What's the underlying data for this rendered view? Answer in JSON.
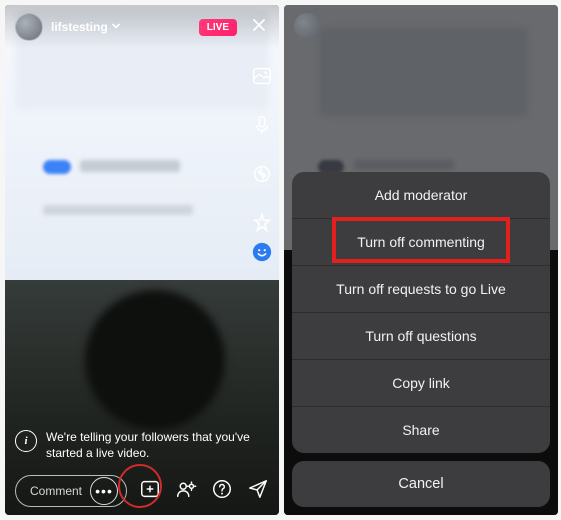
{
  "left": {
    "username": "lifstesting",
    "live_badge": "LIVE",
    "side_icons": [
      "image-icon",
      "mic-icon",
      "camera-flip-icon",
      "filter-icon",
      "blue-face-icon"
    ],
    "notice": "We're telling your followers that you've started a live video.",
    "comment_placeholder": "Comment",
    "bottom_icons": [
      "add-media-icon",
      "add-guest-icon",
      "question-icon",
      "send-icon"
    ]
  },
  "right": {
    "menu": {
      "items": [
        "Add moderator",
        "Turn off commenting",
        "Turn off requests to go Live",
        "Turn off questions",
        "Copy link",
        "Share"
      ],
      "cancel": "Cancel"
    },
    "highlight_index": 0
  },
  "colors": {
    "live_badge": "#ff2d6e",
    "annotation": "#e2211f"
  }
}
